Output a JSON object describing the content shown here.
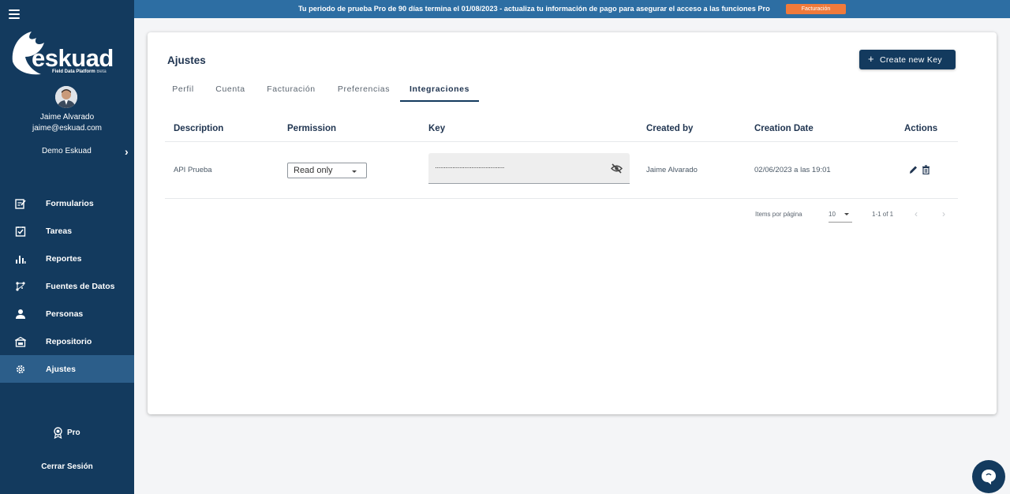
{
  "banner": {
    "text": "Tu periodo de prueba Pro de 90 días termina el 01/08/2023 - actualiza tu información de pago para asegurar el acceso a las funciones Pro",
    "button": "Facturación"
  },
  "sidebar": {
    "logo_text": "eskuad",
    "logo_sub": "Field Data Platform",
    "logo_sub_beta": "Beta",
    "user_name": "Jaime Alvarado",
    "user_email": "jaime@eskuad.com",
    "org": "Demo Eskuad",
    "items": [
      {
        "label": "Formularios",
        "icon": "form-icon"
      },
      {
        "label": "Tareas",
        "icon": "task-check-icon"
      },
      {
        "label": "Reportes",
        "icon": "bar-chart-icon"
      },
      {
        "label": "Fuentes de Datos",
        "icon": "data-source-icon"
      },
      {
        "label": "Personas",
        "icon": "person-icon"
      },
      {
        "label": "Repositorio",
        "icon": "repository-icon"
      },
      {
        "label": "Ajustes",
        "icon": "gear-icon",
        "active": true
      }
    ],
    "pro_label": "Pro",
    "logout_label": "Cerrar Sesión"
  },
  "main": {
    "title": "Ajustes",
    "create_button": "Create new Key",
    "tabs": [
      {
        "label": "Perfil"
      },
      {
        "label": "Cuenta"
      },
      {
        "label": "Facturación"
      },
      {
        "label": "Preferencias"
      },
      {
        "label": "Integraciones",
        "active": true
      }
    ],
    "table": {
      "headers": [
        "Description",
        "Permission",
        "Key",
        "Created by",
        "Creation Date",
        "Actions"
      ],
      "rows": [
        {
          "description": "API Prueba",
          "permission": "Read only",
          "key": "········································",
          "created_by": "Jaime Alvarado",
          "creation_date": "02/06/2023 a las 19:01"
        }
      ]
    },
    "paginator": {
      "items_label": "Items por página",
      "page_size": "10",
      "range": "1-1 of 1"
    }
  },
  "colors": {
    "sidebar": "#133a5e",
    "banner": "#2d6ea3",
    "banner_button": "#f07a3b",
    "active_nav": "#2c5e8a"
  }
}
